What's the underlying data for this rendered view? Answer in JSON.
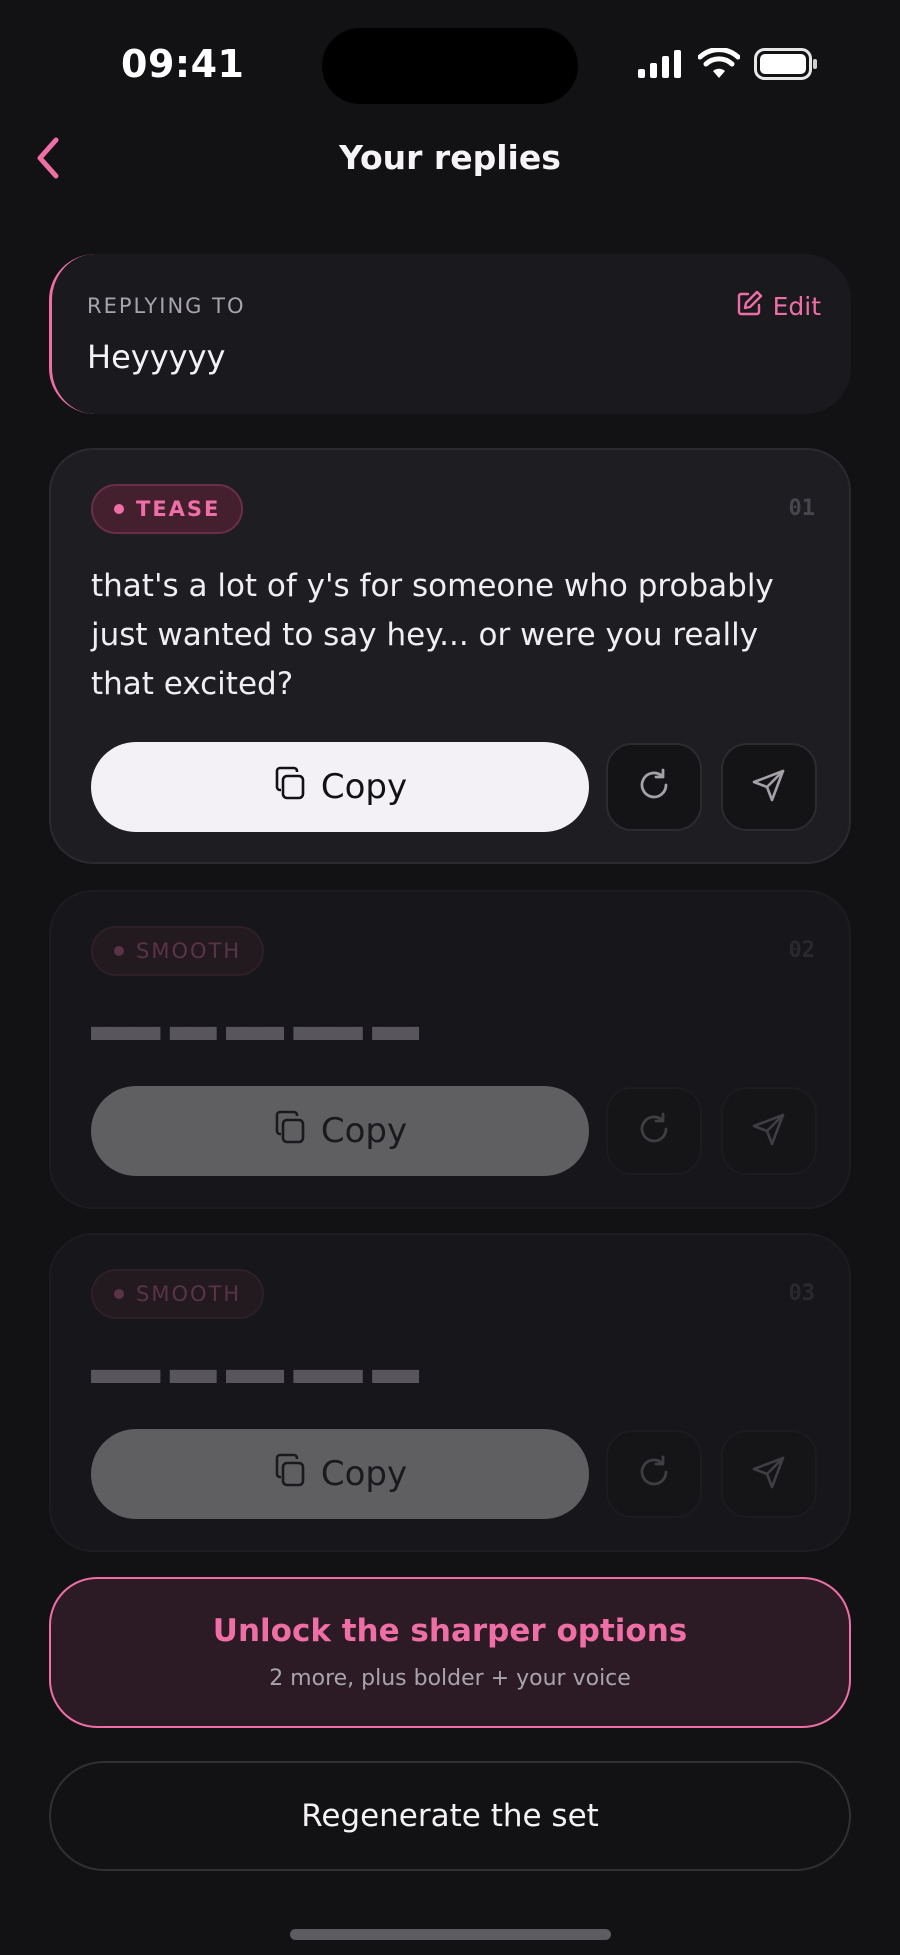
{
  "status_bar": {
    "time": "09:41"
  },
  "header": {
    "title": "Your replies",
    "back_icon": "chevron-left-icon"
  },
  "replying_to": {
    "label": "REPLYING TO",
    "message": "Heyyyyy",
    "edit_label": "Edit"
  },
  "replies": [
    {
      "tag": "TEASE",
      "number": "01",
      "text": "that's a lot of y's for someone who probably just wanted to say hey... or were you really that excited?",
      "copy_label": "Copy",
      "locked": false
    },
    {
      "tag": "SMOOTH",
      "number": "02",
      "text": "■■■■■■ ■■■■ ■■■■■ ■■■■■■ ■■■■",
      "copy_label": "Copy",
      "locked": true
    },
    {
      "tag": "SMOOTH",
      "number": "03",
      "text": "■■■■■■ ■■■■ ■■■■■ ■■■■■■ ■■■■",
      "copy_label": "Copy",
      "locked": true
    }
  ],
  "unlock": {
    "title": "Unlock the sharper options",
    "subtitle": "2 more, plus bolder + your voice"
  },
  "regenerate_label": "Regenerate the set",
  "colors": {
    "background": "#121214",
    "accent": "#ee6ea5",
    "card": "#1e1d22",
    "copy_button": "#f3f1f5"
  }
}
